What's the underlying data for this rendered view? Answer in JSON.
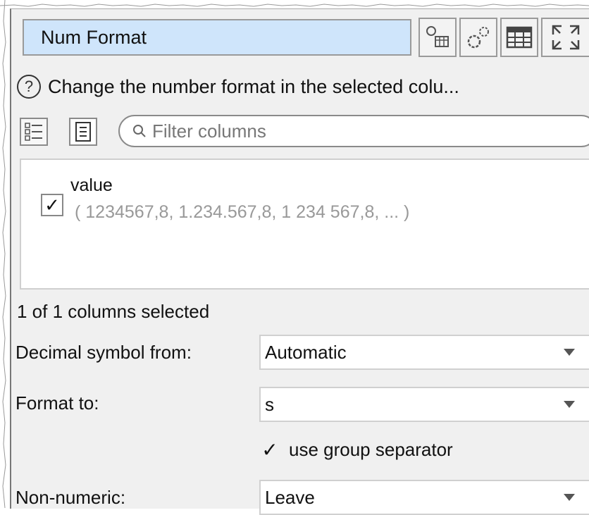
{
  "title": "Num Format",
  "help_text": "Change the number format in the selected colu...",
  "filter": {
    "placeholder": "Filter columns"
  },
  "columns": [
    {
      "name": "value",
      "sample": "( 1234567,8, 1.234.567,8, 1 234 567,8, ... )",
      "checked": true
    }
  ],
  "status": "1 of 1 columns selected",
  "decimal_symbol": {
    "label": "Decimal symbol from:",
    "value": "Automatic"
  },
  "format_to": {
    "label": "Format to:",
    "value": "s"
  },
  "group_separator": {
    "label": "use group separator",
    "checked": true
  },
  "non_numeric": {
    "label": "Non-numeric:",
    "value": "Leave"
  },
  "icons": {
    "toolbar": [
      "transform-table-icon",
      "settings-gear-icon",
      "table-icon",
      "expand-icon"
    ],
    "select_all": "checklist-icon",
    "deselect_all": "list-icon",
    "help": "help-icon",
    "search": "search-icon"
  }
}
